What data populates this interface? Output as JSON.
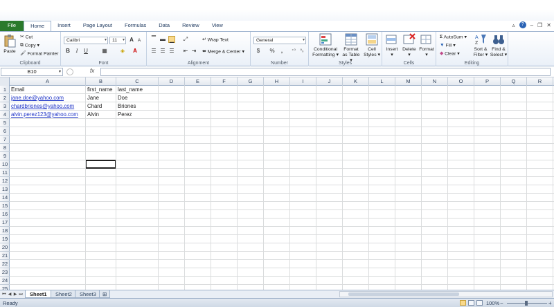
{
  "tabs": [
    "File",
    "Home",
    "Insert",
    "Page Layout",
    "Formulas",
    "Data",
    "Review",
    "View"
  ],
  "active_tab": "Home",
  "ribbon": {
    "clipboard": {
      "label": "Clipboard",
      "paste": "Paste",
      "cut": "Cut",
      "copy": "Copy",
      "format_painter": "Format Painter"
    },
    "font": {
      "label": "Font",
      "name": "Calibri",
      "size": "11",
      "bold": "B",
      "italic": "I",
      "underline": "U",
      "grow": "A",
      "shrink": "A"
    },
    "alignment": {
      "label": "Alignment",
      "wrap_text": "Wrap Text",
      "merge_center": "Merge & Center"
    },
    "number": {
      "label": "Number",
      "format": "General",
      "currency": "$",
      "percent": "%",
      "comma": ","
    },
    "styles": {
      "label": "Styles",
      "conditional": "Conditional Formatting",
      "conditional_1": "Conditional",
      "conditional_2": "Formatting",
      "format_table_1": "Format",
      "format_table_2": "as Table",
      "cell_styles_1": "Cell",
      "cell_styles_2": "Styles"
    },
    "cells": {
      "label": "Cells",
      "insert": "Insert",
      "delete": "Delete",
      "format": "Format"
    },
    "editing": {
      "label": "Editing",
      "autosum": "AutoSum",
      "fill": "Fill",
      "clear": "Clear",
      "sort_1": "Sort &",
      "sort_2": "Filter",
      "find_1": "Find &",
      "find_2": "Select"
    }
  },
  "formula_bar": {
    "name_box": "B10",
    "fx": "fx",
    "value": ""
  },
  "columns": [
    "A",
    "B",
    "C",
    "D",
    "E",
    "F",
    "G",
    "H",
    "I",
    "J",
    "K",
    "L",
    "M",
    "N",
    "O",
    "P",
    "Q",
    "R"
  ],
  "rows": [
    "1",
    "2",
    "3",
    "4",
    "5",
    "6",
    "7",
    "8",
    "9",
    "10",
    "11",
    "12",
    "13",
    "14",
    "15",
    "16",
    "17",
    "18",
    "19",
    "20",
    "21",
    "22",
    "23",
    "24",
    "25"
  ],
  "cells": {
    "A1": "Email",
    "B1": "first_name",
    "C1": "last_name",
    "A2": "jane.doe@yahoo.com",
    "B2": "Jane",
    "C2": "Doe",
    "A3": "chardbriones@yahoo.com",
    "B3": "Chard",
    "C3": "Briones",
    "A4": "alvin.perez123@yahoo.com",
    "B4": "Alvin",
    "C4": "Perez"
  },
  "sheets": [
    "Sheet1",
    "Sheet2",
    "Sheet3"
  ],
  "active_sheet": "Sheet1",
  "status": {
    "ready": "Ready",
    "zoom": "100%",
    "minus": "−",
    "plus": "+"
  },
  "colors": {
    "file_tab": "#2b7a2b",
    "link": "#1f35c7",
    "accent": "#2a63b5"
  }
}
